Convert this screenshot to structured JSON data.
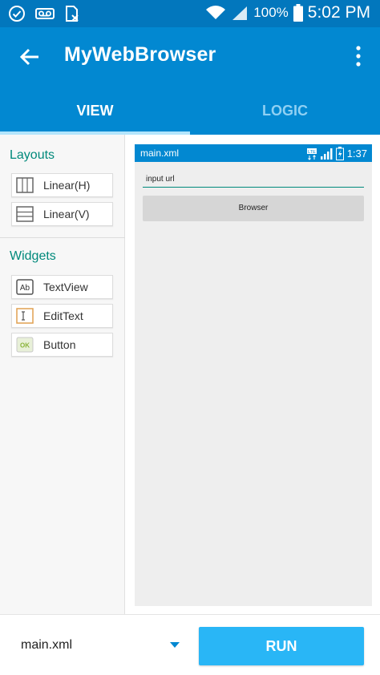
{
  "status_bar": {
    "battery": "100%",
    "time": "5:02 PM",
    "left_icons": [
      "check-circle-icon",
      "voicemail-icon",
      "sim-x-icon"
    ],
    "right_icons": [
      "wifi-icon",
      "signal-icon",
      "battery-icon"
    ]
  },
  "app_bar": {
    "title": "MyWebBrowser",
    "tabs": [
      {
        "label": "VIEW",
        "active": true
      },
      {
        "label": "LOGIC",
        "active": false
      }
    ]
  },
  "palette": {
    "layouts_title": "Layouts",
    "layouts": [
      {
        "label": "Linear(H)",
        "icon": "linear-horizontal-icon"
      },
      {
        "label": "Linear(V)",
        "icon": "linear-vertical-icon"
      }
    ],
    "widgets_title": "Widgets",
    "widgets": [
      {
        "label": "TextView",
        "icon": "textview-icon"
      },
      {
        "label": "EditText",
        "icon": "edittext-icon"
      },
      {
        "label": "Button",
        "icon": "button-icon"
      }
    ]
  },
  "preview": {
    "file": "main.xml",
    "device_time": "1:37",
    "network": "LTE",
    "input_text": "input url",
    "button_label": "Browser"
  },
  "bottom_bar": {
    "selected_file": "main.xml",
    "run_label": "RUN"
  },
  "colors": {
    "status_bar": "#0277bd",
    "app_bar": "#0288d1",
    "accent": "#00897b",
    "run_button": "#29b6f6"
  }
}
